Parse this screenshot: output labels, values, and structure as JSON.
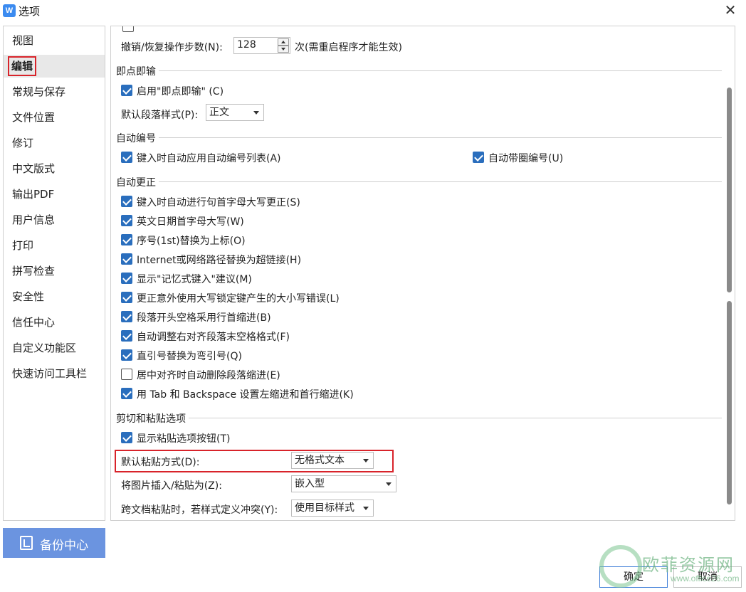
{
  "window": {
    "app_icon_glyph": "W",
    "title": "选项",
    "close_glyph": "✕"
  },
  "sidebar": {
    "items": [
      {
        "label": "视图",
        "active": false
      },
      {
        "label": "编辑",
        "active": true
      },
      {
        "label": "常规与保存",
        "active": false
      },
      {
        "label": "文件位置",
        "active": false
      },
      {
        "label": "修订",
        "active": false
      },
      {
        "label": "中文版式",
        "active": false
      },
      {
        "label": "输出PDF",
        "active": false
      },
      {
        "label": "用户信息",
        "active": false
      },
      {
        "label": "打印",
        "active": false
      },
      {
        "label": "拼写检查",
        "active": false
      },
      {
        "label": "安全性",
        "active": false
      },
      {
        "label": "信任中心",
        "active": false
      },
      {
        "label": "自定义功能区",
        "active": false
      },
      {
        "label": "快速访问工具栏",
        "active": false
      }
    ],
    "backup_label": "备份中心"
  },
  "main": {
    "top_cut_checkbox": {
      "checked": false
    },
    "undo": {
      "label": "撤销/恢复操作步数(N):",
      "value": "128",
      "suffix": "次(需重启程序才能生效)"
    },
    "instant_input": {
      "title": "即点即输",
      "enable_label": "启用\"即点即输\" (C)",
      "enable_checked": true,
      "para_style_label": "默认段落样式(P):",
      "para_style_value": "正文"
    },
    "auto_number": {
      "title": "自动编号",
      "list_label": "键入时自动应用自动编号列表(A)",
      "list_checked": true,
      "circle_label": "自动带圈编号(U)",
      "circle_checked": true
    },
    "auto_correct": {
      "title": "自动更正",
      "items": [
        {
          "label": "键入时自动进行句首字母大写更正(S)",
          "checked": true
        },
        {
          "label": "英文日期首字母大写(W)",
          "checked": true
        },
        {
          "label": "序号(1st)替换为上标(O)",
          "checked": true
        },
        {
          "label": "Internet或网络路径替换为超链接(H)",
          "checked": true
        },
        {
          "label": "显示\"记忆式键入\"建议(M)",
          "checked": true
        },
        {
          "label": "更正意外使用大写锁定键产生的大小写错误(L)",
          "checked": true
        },
        {
          "label": "段落开头空格采用行首缩进(B)",
          "checked": true
        },
        {
          "label": "自动调整右对齐段落末空格格式(F)",
          "checked": true
        },
        {
          "label": "直引号替换为弯引号(Q)",
          "checked": true
        },
        {
          "label": "居中对齐时自动删除段落缩进(E)",
          "checked": false
        },
        {
          "label": "用 Tab 和 Backspace 设置左缩进和首行缩进(K)",
          "checked": true
        }
      ]
    },
    "paste": {
      "title": "剪切和粘贴选项",
      "show_btn_label": "显示粘贴选项按钮(T)",
      "show_btn_checked": true,
      "default_label": "默认粘贴方式(D):",
      "default_value": "无格式文本",
      "image_label": "将图片插入/粘贴为(Z):",
      "image_value": "嵌入型",
      "conflict_label": "跨文档粘贴时，若样式定义冲突(Y):",
      "conflict_value": "使用目标样式"
    }
  },
  "buttons": {
    "ok": "确定",
    "cancel": "取消"
  },
  "watermark": {
    "text": "欧菲资源网",
    "sub": "www.office26.com"
  },
  "colors": {
    "accent": "#2a6ebd",
    "highlight": "#d8232a",
    "backup_bg": "#6b94e0"
  }
}
